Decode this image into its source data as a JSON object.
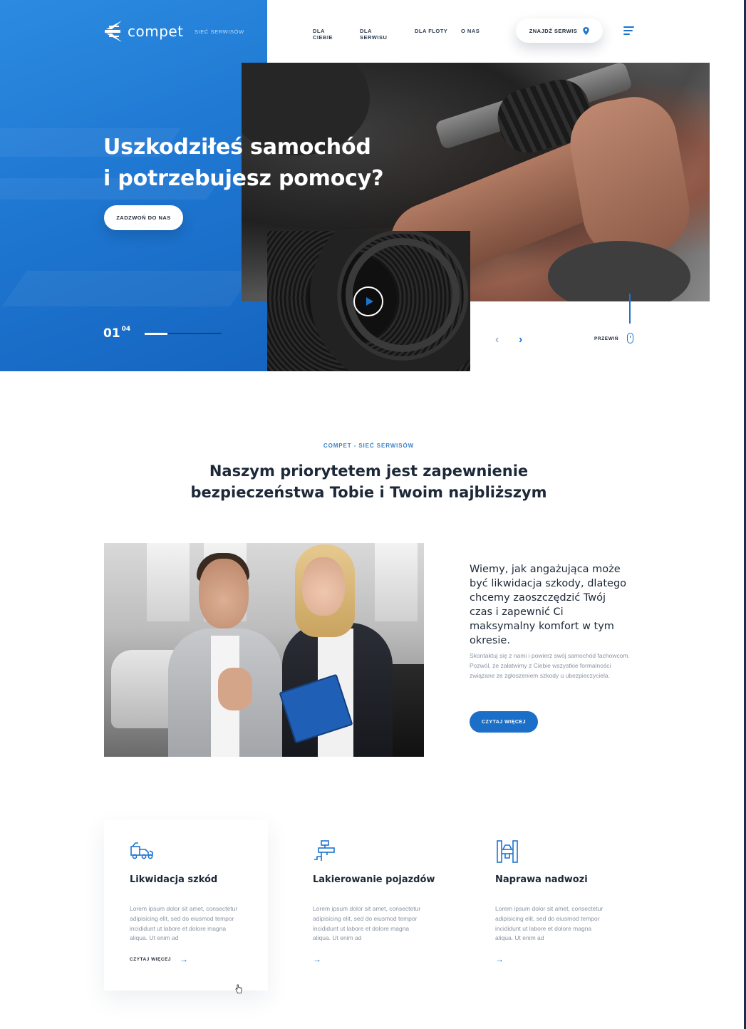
{
  "brand": {
    "logo_text": "compet",
    "subtitle": "SIEĆ SERWISÓW"
  },
  "nav": {
    "items": [
      "DLA CIEBIE",
      "DLA SERWISU",
      "DLA FLOTY",
      "O NAS"
    ],
    "find_service_label": "ZNAJDŹ SERWIS"
  },
  "hero": {
    "title_line1": "Uszkodziłeś samochód",
    "title_line2": "i potrzebujesz pomocy?",
    "cta_label": "ZADZWOŃ DO NAS",
    "slide_current": "01",
    "slide_total": "04",
    "progress": 0.3,
    "scroll_label": "PRZEWIŃ"
  },
  "intro": {
    "eyebrow": "COMPET - SIEĆ SERWISÓW",
    "title_line1": "Naszym priorytetem jest zapewnienie",
    "title_line2": "bezpieczeństwa Tobie i Twoim najbliższym",
    "lead": "Wiemy, jak angażująca może być likwidacja szkody, dlatego chcemy zaoszczędzić Twój czas i zapewnić Ci maksymalny komfort w tym okresie.",
    "body": "Skontaktuj się z nami i powierz swój samochód fachowcom. Pozwól, że załatwimy z Ciebie wszystkie formalności związane ze zgłoszeniem szkody u ubezpieczyciela.",
    "read_more_label": "CZYTAJ WIĘCEJ"
  },
  "services": [
    {
      "title": "Likwidacja szkód",
      "text": "Lorem ipsum dolor sit amet, consectetur adipisicing elit, sed do eiusmod tempor incididunt ut labore et dolore magna aliqua. Ut enim ad",
      "link_label": "CZYTAJ WIĘCEJ",
      "icon": "tow-truck-icon"
    },
    {
      "title": "Lakierowanie pojazdów",
      "text": "Lorem ipsum dolor sit amet, consectetur adipisicing elit, sed do eiusmod tempor incididunt ut labore et dolore magna aliqua. Ut enim ad",
      "icon": "spray-gun-icon"
    },
    {
      "title": "Naprawa nadwozi",
      "text": "Lorem ipsum dolor sit amet, consectetur adipisicing elit, sed do eiusmod tempor incididunt ut labore et dolore magna aliqua. Ut enim ad",
      "icon": "car-lift-icon"
    }
  ],
  "colors": {
    "accent": "#1b74cf",
    "hero_blue": "#1f78d2",
    "dark_text": "#1d2838",
    "muted_text": "#8a93a3"
  }
}
